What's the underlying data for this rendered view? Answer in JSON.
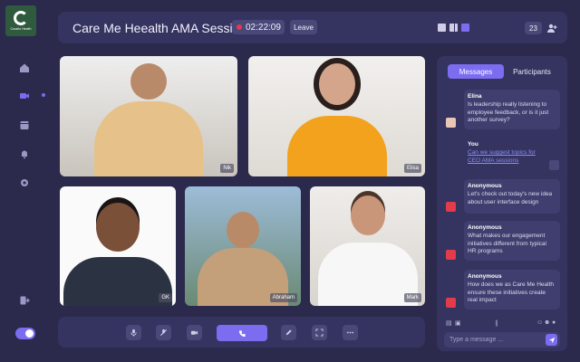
{
  "brand": {
    "logo_text": "Curatio Health"
  },
  "header": {
    "title": "Care Me Heealth AMA Session",
    "timer": "02:22:09",
    "leave_label": "Leave",
    "participant_count": "23"
  },
  "participants": [
    {
      "name": "Nik"
    },
    {
      "name": "Elisa"
    },
    {
      "name": "GK"
    },
    {
      "name": "Abraham"
    },
    {
      "name": "Mark"
    }
  ],
  "chat": {
    "tabs": [
      "Messages",
      "Participants"
    ],
    "active_tab": "Messages",
    "messages": [
      {
        "sender": "Elina",
        "text": "Is leadership really listening to employee feedback, or is it just another survey?"
      },
      {
        "sender": "You",
        "text": "Can we suggest topics for CEO AMA sessions"
      },
      {
        "sender": "Anonymous",
        "text": "Let's check out today's new idea about user interface design"
      },
      {
        "sender": "Anonymous",
        "text": "What makes our engagement initiatives different from typical HR programs"
      },
      {
        "sender": "Anonymous",
        "text": "How does we as Care Me Health ensure these initiatives create real impact"
      }
    ],
    "input_placeholder": "Type a message ..."
  },
  "colors": {
    "background": "#2b2a4c",
    "panel": "#353460",
    "accent": "#7b6cf0",
    "record": "#e23b4a"
  },
  "icons": {
    "sidebar": [
      "home-icon",
      "video-icon",
      "calendar-icon",
      "bell-icon",
      "settings-icon",
      "logout-icon",
      "theme-moon-icon"
    ],
    "controls": [
      "microphone-icon",
      "mute-icon",
      "camera-icon",
      "phone-icon",
      "edit-icon",
      "fullscreen-icon",
      "more-icon"
    ]
  }
}
